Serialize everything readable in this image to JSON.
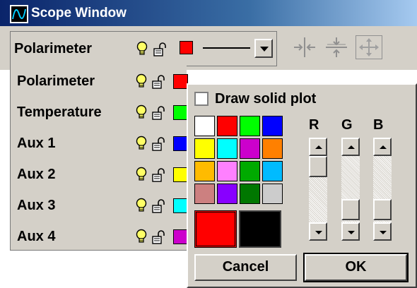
{
  "window": {
    "title": "Scope Window"
  },
  "top_channel": {
    "label": "Polarimeter",
    "color": "#ff0000"
  },
  "channels": [
    {
      "label": "Polarimeter",
      "color": "#ff0000"
    },
    {
      "label": "Temperature",
      "color": "#00ff00"
    },
    {
      "label": "Aux 1",
      "color": "#0000ff"
    },
    {
      "label": "Aux 2",
      "color": "#ffff00"
    },
    {
      "label": "Aux 3",
      "color": "#00ffff"
    },
    {
      "label": "Aux 4",
      "color": "#cc00cc"
    }
  ],
  "dialog": {
    "checkbox_label": "Draw solid plot",
    "checkbox_checked": false,
    "palette": [
      "#ffffff",
      "#ff0000",
      "#00ff00",
      "#0000ff",
      "#ffff00",
      "#00ffff",
      "#cc00cc",
      "#ff8000",
      "#ffbb00",
      "#ff80ff",
      "#00aa00",
      "#00bbff",
      "#cc8080",
      "#8800ff",
      "#007700",
      "#cccccc"
    ],
    "current_color": "#ff0000",
    "new_color": "#000000",
    "channels": [
      "R",
      "G",
      "B"
    ],
    "cancel_label": "Cancel",
    "ok_label": "OK"
  }
}
